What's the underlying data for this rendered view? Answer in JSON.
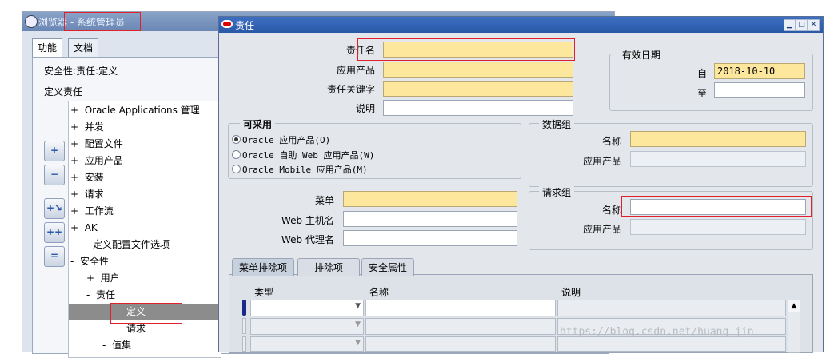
{
  "background_window": {
    "title": "浏览器 - 系统管理员",
    "tabs": [
      "功能",
      "文档"
    ],
    "line1": "安全性:责任:定义",
    "line2": "定义责任",
    "tree": [
      {
        "prefix": "+",
        "label": "Oracle Applications 管理"
      },
      {
        "prefix": "+",
        "label": "并发"
      },
      {
        "prefix": "+",
        "label": "配置文件"
      },
      {
        "prefix": "+",
        "label": "应用产品"
      },
      {
        "prefix": "+",
        "label": "安装"
      },
      {
        "prefix": "+",
        "label": "请求"
      },
      {
        "prefix": "+",
        "label": "工作流"
      },
      {
        "prefix": "+",
        "label": "AK"
      },
      {
        "prefix": "",
        "label": "定义配置文件选项"
      },
      {
        "prefix": "-",
        "label": "安全性"
      },
      {
        "prefix": "+",
        "label": "用户"
      },
      {
        "prefix": "-",
        "label": "责任"
      },
      {
        "prefix": "",
        "label": "定义"
      },
      {
        "prefix": "",
        "label": "请求"
      },
      {
        "prefix": "-",
        "label": "值集"
      }
    ],
    "tree_buttons": [
      "plus-icon",
      "minus-icon",
      "expand-branch-icon",
      "expand-all-icon",
      "collapse-all-icon"
    ]
  },
  "dialog": {
    "title": "责任",
    "fields": {
      "resp_name": {
        "label": "责任名",
        "value": ""
      },
      "app": {
        "label": "应用产品",
        "value": ""
      },
      "key": {
        "label": "责任关键字",
        "value": ""
      },
      "desc": {
        "label": "说明",
        "value": ""
      }
    },
    "effective": {
      "title": "有效日期",
      "from_label": "自",
      "from_value": "2018-10-10",
      "to_label": "至",
      "to_value": ""
    },
    "available": {
      "title": "可采用",
      "options": [
        "Oracle 应用产品(O)",
        "Oracle 自助 Web 应用产品(W)",
        "Oracle Mobile 应用产品(M)"
      ],
      "selected": 0
    },
    "data_group": {
      "title": "数据组",
      "name_label": "名称",
      "app_label": "应用产品"
    },
    "menu": {
      "menu_label": "菜单",
      "web_host_label": "Web 主机名",
      "web_agent_label": "Web 代理名"
    },
    "request_group": {
      "title": "请求组",
      "name_label": "名称",
      "app_label": "应用产品"
    },
    "bottom_tabs": [
      "菜单排除项",
      "排除项",
      "安全属性"
    ],
    "grid_headers": [
      "类型",
      "名称",
      "说明"
    ]
  },
  "watermark": "https://blog.csdn.net/huang_jin_",
  "colors": {
    "required_field": "#fde79c",
    "title_bar": "#2a58a6",
    "highlight_box": "#e0202a"
  }
}
